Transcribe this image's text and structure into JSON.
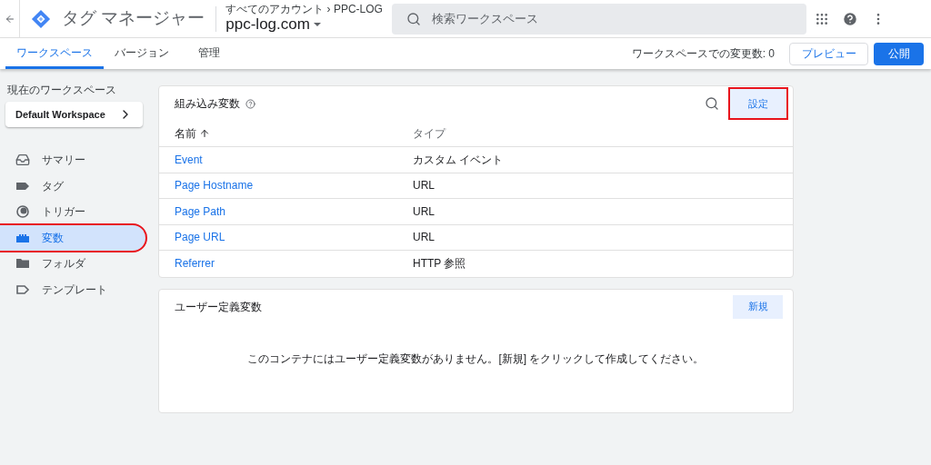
{
  "header": {
    "app_title": "タグ マネージャー",
    "breadcrumb": "すべてのアカウント › PPC-LOG",
    "container": "ppc-log.com",
    "search": {
      "placeholder": "検索ワークスペース"
    }
  },
  "tabs": [
    {
      "label": "ワークスペース",
      "selected": true
    },
    {
      "label": "バージョン",
      "selected": false
    },
    {
      "label": "管理",
      "selected": false
    }
  ],
  "changes": "ワークスペースでの変更数: 0",
  "preview_button": "プレビュー",
  "publish_button": "公開",
  "sidebar": {
    "workspace_label": "現在のワークスペース",
    "workspace": "Default Workspace",
    "items": [
      {
        "label": "サマリー",
        "kind": "summary",
        "selected": false,
        "highlighted": false
      },
      {
        "label": "タグ",
        "kind": "tag",
        "selected": false,
        "highlighted": false
      },
      {
        "label": "トリガー",
        "kind": "trigger",
        "selected": false,
        "highlighted": false
      },
      {
        "label": "変数",
        "kind": "variable",
        "selected": true,
        "highlighted": true
      },
      {
        "label": "フォルダ",
        "kind": "folder",
        "selected": false,
        "highlighted": false
      },
      {
        "label": "テンプレート",
        "kind": "template",
        "selected": false,
        "highlighted": false
      }
    ]
  },
  "builtin": {
    "title": "組み込み変数",
    "configure_button": {
      "label": "設定",
      "highlighted": true
    },
    "columns": [
      "名前",
      "タイプ"
    ],
    "rows": [
      {
        "name": "Event",
        "type": "カスタム イベント"
      },
      {
        "name": "Page Hostname",
        "type": "URL"
      },
      {
        "name": "Page Path",
        "type": "URL"
      },
      {
        "name": "Page URL",
        "type": "URL"
      },
      {
        "name": "Referrer",
        "type": "HTTP 参照"
      }
    ]
  },
  "user_defined": {
    "title": "ユーザー定義変数",
    "new_button": "新規",
    "empty_message": "このコンテナにはユーザー定義変数がありません。[新規] をクリックして作成してください。"
  }
}
